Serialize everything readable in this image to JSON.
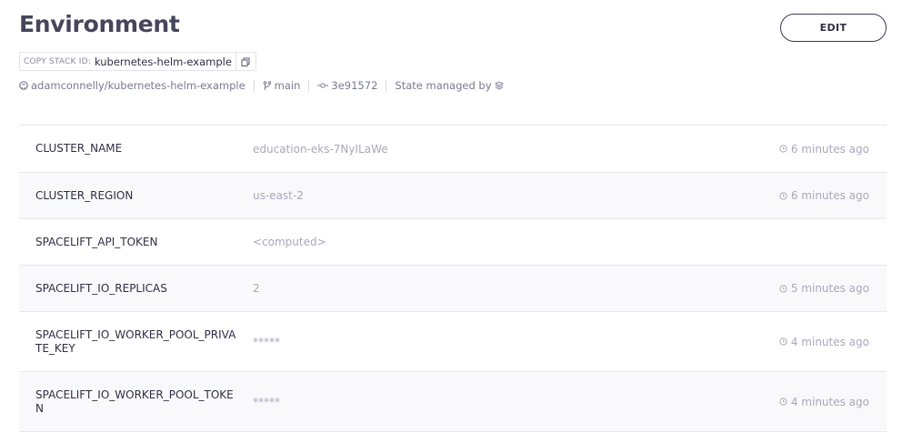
{
  "header": {
    "title": "Environment",
    "edit_label": "EDIT"
  },
  "stack_id": {
    "label": "COPY STACK ID:",
    "value": "kubernetes-helm-example"
  },
  "meta": {
    "repo": "adamconnelly/kubernetes-helm-example",
    "branch": "main",
    "commit": "3e91572",
    "state_managed_by": "State managed by"
  },
  "variables": [
    {
      "name": "CLUSTER_NAME",
      "value": "education-eks-7NyILaWe",
      "time": "6 minutes ago"
    },
    {
      "name": "CLUSTER_REGION",
      "value": "us-east-2",
      "time": "6 minutes ago"
    },
    {
      "name": "SPACELIFT_API_TOKEN",
      "value": "<computed>",
      "time": ""
    },
    {
      "name": "SPACELIFT_IO_REPLICAS",
      "value": "2",
      "time": "5 minutes ago"
    },
    {
      "name": "SPACELIFT_IO_WORKER_POOL_PRIVATE_KEY",
      "value": "*****",
      "time": "4 minutes ago"
    },
    {
      "name": "SPACELIFT_IO_WORKER_POOL_TOKEN",
      "value": "*****",
      "time": "4 minutes ago"
    }
  ]
}
